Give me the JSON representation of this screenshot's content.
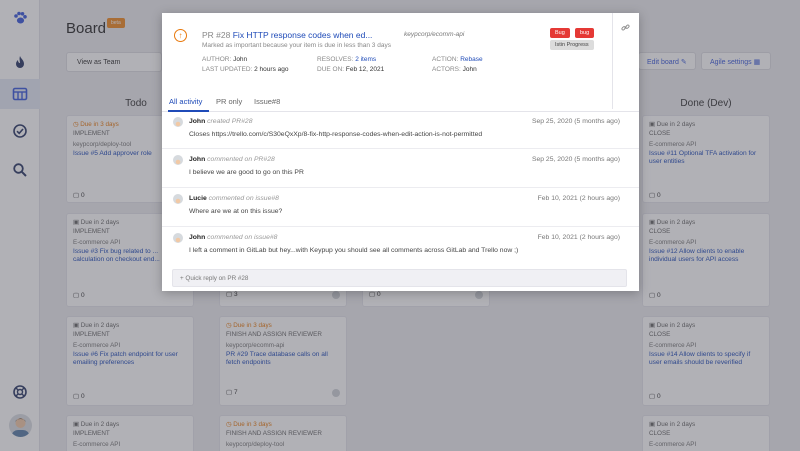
{
  "sidebar": {
    "items": [
      "paw-logo",
      "fire",
      "board",
      "check",
      "search",
      "help"
    ]
  },
  "board": {
    "title": "Board",
    "beta_badge": "beta",
    "view_as": "View as Team",
    "edit_board": "Edit board",
    "agile_settings": "Agile settings",
    "columns": [
      "Todo",
      "Done (Dev)"
    ],
    "cards": [
      {
        "due": "Due in 3 days",
        "stage": "IMPLEMENT",
        "project": "keypcorp/deploy-tool",
        "title": "Issue #5 Add approver role",
        "count": "0"
      },
      {
        "due": "Due in 2 days",
        "stage": "IMPLEMENT",
        "project": "E-commerce API",
        "title": "Issue #3 Fix bug related to ... calculation on checkout end...",
        "count": "0"
      },
      {
        "due": "Due in 2 days",
        "stage": "IMPLEMENT",
        "project": "E-commerce API",
        "title": "Issue #6 Fix patch endpoint for user emailing preferences",
        "count": "0"
      },
      {
        "due": "Due in 2 days",
        "stage": "IMPLEMENT",
        "project": "E-commerce API",
        "title": "",
        "count": ""
      },
      {
        "due": "",
        "stage": "",
        "project": "",
        "title": "",
        "count": "3"
      },
      {
        "due": "Due in 3 days",
        "stage": "FINISH AND ASSIGN REVIEWER",
        "project": "keypcorp/ecomm-api",
        "title": "PR #29 Trace database calls on all fetch endpoints",
        "count": "7"
      },
      {
        "due": "Due in 3 days",
        "stage": "FINISH AND ASSIGN REVIEWER",
        "project": "keypcorp/deploy-tool",
        "title": "",
        "count": ""
      },
      {
        "due": "",
        "stage": "",
        "project": "",
        "title": "",
        "count": "0"
      },
      {
        "due": "Due in 2 days",
        "stage": "CLOSE",
        "project": "E-commerce API",
        "title": "Issue #11 Optional TFA activation for user entities",
        "count": "0"
      },
      {
        "due": "Due in 2 days",
        "stage": "CLOSE",
        "project": "E-commerce API",
        "title": "Issue #12 Allow clients to enable individual users for API access",
        "count": "0"
      },
      {
        "due": "Due in 2 days",
        "stage": "CLOSE",
        "project": "E-commerce API",
        "title": "Issue #14 Allow clients to specify if user emails should be reverified",
        "count": "0"
      },
      {
        "due": "Due in 2 days",
        "stage": "CLOSE",
        "project": "E-commerce API",
        "title": "",
        "count": ""
      }
    ]
  },
  "modal": {
    "pr_number": "PR #28",
    "title": "Fix HTTP response codes when ed...",
    "repo": "keypcorp/ecomm-api",
    "reason": "Marked as important because your item is due in less than 3 days",
    "tags": [
      "Bug",
      "bug",
      "Istin Progress"
    ],
    "author_label": "AUTHOR:",
    "author": "John",
    "updated_label": "LAST UPDATED:",
    "updated": "2 hours ago",
    "resolves_label": "RESOLVES:",
    "resolves": "2 items",
    "due_label": "DUE ON:",
    "due": "Feb 12, 2021",
    "action_label": "ACTION:",
    "action": "Rebase",
    "actors_label": "ACTORS:",
    "actors": "John",
    "tabs": [
      "All activity",
      "PR only",
      "Issue#8"
    ],
    "comments": [
      {
        "who": "John",
        "verb": "created PR#28",
        "date": "Sep 25, 2020 (5 months ago)",
        "body": "Closes https://trello.com/c/S30eQxXp/8-fix-http-response-codes-when-edit-action-is-not-permitted"
      },
      {
        "who": "John",
        "verb": "commented on PR#28",
        "date": "Sep 25, 2020 (5 months ago)",
        "body": "I believe we are good to go on this PR"
      },
      {
        "who": "Lucie",
        "verb": "commented on issue#8",
        "date": "Feb 10, 2021 (2 hours ago)",
        "body": "Where are we at on this issue?"
      },
      {
        "who": "John",
        "verb": "commented on issue#8",
        "date": "Feb 10, 2021 (2 hours ago)",
        "body": "I left a comment in GitLab but hey...with Keypup you should see all comments across GitLab and Trello now ;)"
      }
    ],
    "reply_placeholder": "+ Quick reply on PR #28"
  },
  "colors": {
    "accent": "#1f4bb8",
    "warn": "#e8790d",
    "tag_red": "#e53935"
  }
}
